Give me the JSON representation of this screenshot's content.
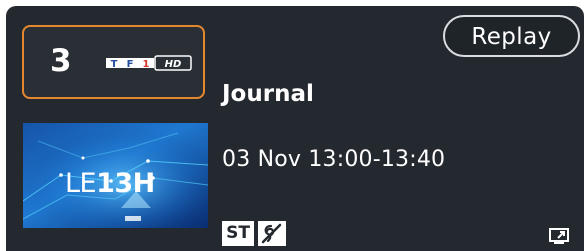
{
  "channel": {
    "number": "3",
    "logo_name": "tf1-hd-logo",
    "logo_primary": "TF1",
    "logo_suffix": "HD"
  },
  "program": {
    "title": "Journal",
    "schedule": "03 Nov 13:00-13:40",
    "thumbnail_caption_light": "LE",
    "thumbnail_caption_bold": "13H"
  },
  "actions": {
    "replay_label": "Replay"
  },
  "badges": {
    "subtitles_label": "ST",
    "hearing_icon": "hearing-impaired-icon",
    "tv_icon": "tv-arrow-icon"
  },
  "colors": {
    "card_background": "#24292f",
    "focus_border": "#e5872f",
    "text": "#ffffff",
    "replay_border": "#d9dde2"
  }
}
